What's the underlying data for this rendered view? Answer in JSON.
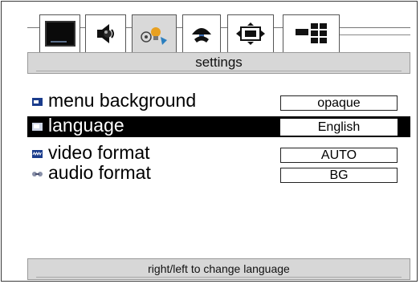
{
  "tabs": [
    {
      "icon": "tv-screen-icon",
      "active": false
    },
    {
      "icon": "speaker-icon",
      "active": false
    },
    {
      "icon": "settings-lightbulb-icon",
      "active": true
    },
    {
      "icon": "broadcast-antenna-icon",
      "active": false
    },
    {
      "icon": "picture-format-icon",
      "active": false
    },
    {
      "icon": "multi-window-icon",
      "active": false
    }
  ],
  "title": "settings",
  "rows": [
    {
      "icon": "menu-background-icon",
      "label": "menu background",
      "value": "opaque",
      "selected": false
    },
    {
      "icon": "language-icon",
      "label": "language",
      "value": "English",
      "selected": true
    },
    {
      "icon": "video-format-icon",
      "label": "video format",
      "value": "AUTO",
      "selected": false
    },
    {
      "icon": "audio-format-icon",
      "label": "audio format",
      "value": "BG",
      "selected": false
    }
  ],
  "hint": "right/left to change language",
  "colors": {
    "selected_row": "#000000",
    "bar": "#d7d7d7",
    "icon_blue": "#1a3c8c"
  }
}
